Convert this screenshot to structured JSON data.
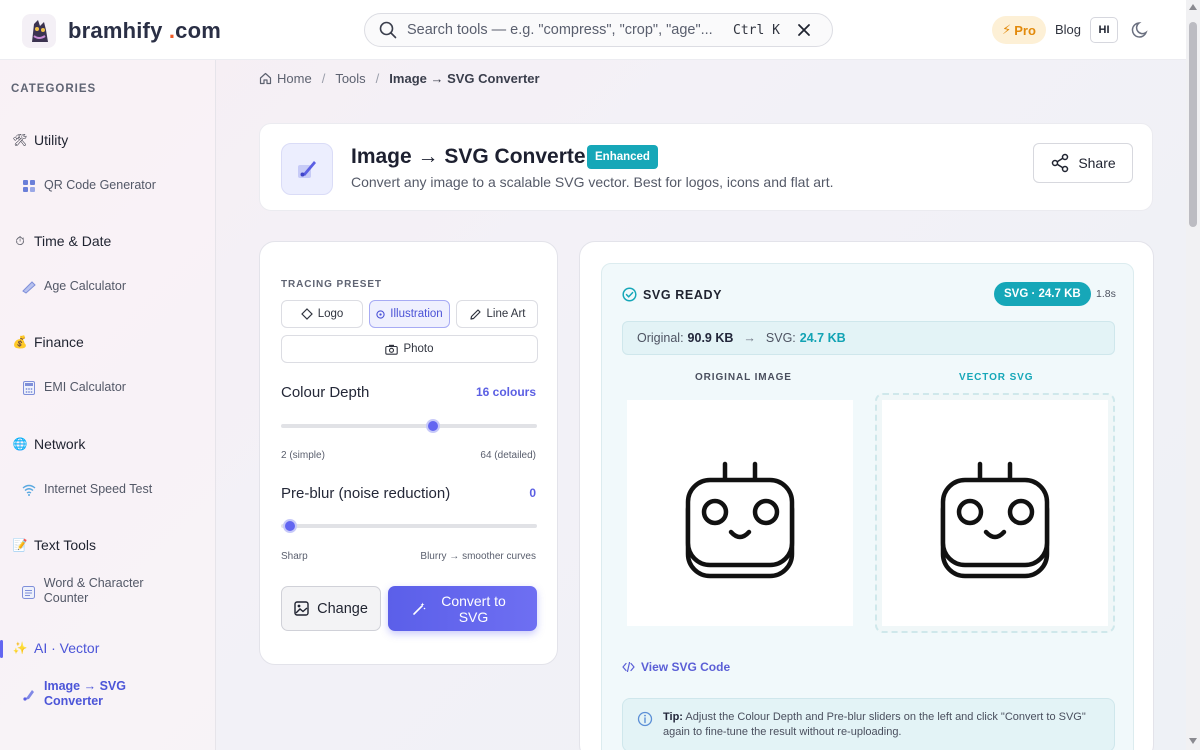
{
  "header": {
    "logo": {
      "name": "bramhify",
      "dot": ".",
      "tld": "com"
    },
    "search": {
      "placeholder": "Search tools — e.g. \"compress\", \"crop\", \"age\"...",
      "shortcut": "Ctrl K"
    },
    "pro_label": "Pro",
    "blog_label": "Blog",
    "lang_label": "HI"
  },
  "sidebar": {
    "title": "CATEGORIES",
    "categories": [
      {
        "label": "Utility",
        "icon": "tools-icon",
        "items": [
          {
            "label": "QR Code Generator",
            "icon": "qr-icon"
          }
        ]
      },
      {
        "label": "Time & Date",
        "icon": "stopwatch-icon",
        "items": [
          {
            "label": "Age Calculator",
            "icon": "calendar-icon"
          }
        ]
      },
      {
        "label": "Finance",
        "icon": "money-bag-icon",
        "items": [
          {
            "label": "EMI Calculator",
            "icon": "calculator-icon"
          }
        ]
      },
      {
        "label": "Network",
        "icon": "globe-icon",
        "items": [
          {
            "label": "Internet Speed Test",
            "icon": "wifi-icon"
          }
        ]
      },
      {
        "label": "Text Tools",
        "icon": "memo-icon",
        "items": [
          {
            "label": "Word & Character Counter",
            "icon": "counter-icon"
          }
        ]
      },
      {
        "label": "AI · Vector",
        "icon": "sparkles-icon",
        "items": [
          {
            "label": "Image → SVG Converter",
            "icon": "image-svg-icon"
          }
        ]
      }
    ]
  },
  "breadcrumb": {
    "home": "Home",
    "tools": "Tools",
    "current": "Image → SVG Converter",
    "sep": "/"
  },
  "tool": {
    "title": "Image → SVG Converter",
    "badge": "Enhanced",
    "subtitle": "Convert any image to a scalable SVG vector. Best for logos, icons and flat art.",
    "share_label": "Share"
  },
  "settings": {
    "preset_label": "TRACING PRESET",
    "presets": [
      "Logo",
      "Illustration",
      "Line Art",
      "Photo"
    ],
    "active_preset": "Illustration",
    "colour_depth": {
      "title": "Colour Depth",
      "value_label": "16 colours",
      "value": 16,
      "min": 2,
      "max": 64,
      "min_label": "2 (simple)",
      "max_label": "64 (detailed)"
    },
    "preblur": {
      "title": "Pre-blur (noise reduction)",
      "value_label": "0",
      "value": 0,
      "min": 0,
      "max": 10,
      "min_label": "Sharp",
      "max_label": "Blurry → smoother curves"
    },
    "change_label": "Change",
    "convert_label": "Convert to SVG"
  },
  "result": {
    "status": "SVG READY",
    "pill": "SVG · 24.7 KB",
    "time": "1.8s",
    "original_label": "Original:",
    "original_size": "90.9 KB",
    "arrow": "→",
    "svg_label": "SVG:",
    "svg_size": "24.7 KB",
    "col_original": "ORIGINAL IMAGE",
    "col_vector": "VECTOR SVG",
    "view_code": "View SVG Code",
    "tip_bold": "Tip:",
    "tip_text": "Adjust the Colour Depth and Pre-blur sliders on the left and click \"Convert to SVG\" again to fine-tune the result without re-uploading."
  },
  "colors": {
    "accent": "#6366f1",
    "teal": "#16a7b8",
    "pro": "#e28a0c"
  }
}
